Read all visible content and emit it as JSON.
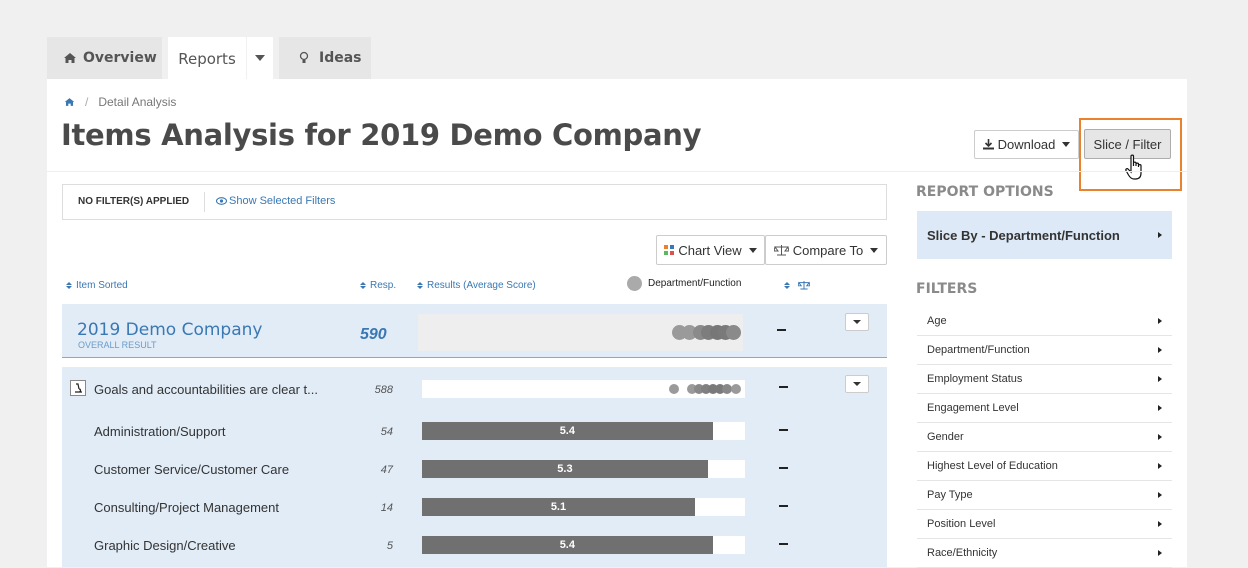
{
  "tabs": {
    "overview": "Overview",
    "reports": "Reports",
    "ideas": "Ideas"
  },
  "breadcrumb": {
    "current": "Detail Analysis"
  },
  "page_title": "Items Analysis for 2019 Demo Company",
  "toolbar": {
    "download_label": "Download",
    "slice_filter_label": "Slice / Filter"
  },
  "filterbar": {
    "status": "NO FILTER(S) APPLIED",
    "show_filters": "Show Selected Filters"
  },
  "view_controls": {
    "chart_view": "Chart View",
    "compare_to": "Compare To"
  },
  "columns": {
    "item_sorted": "Item Sorted",
    "resp": "Resp.",
    "results": "Results (Average Score)",
    "legend": "Department/Function"
  },
  "overall": {
    "name": "2019 Demo Company",
    "sublabel": "OVERALL RESULT",
    "resp": "590"
  },
  "item": {
    "label": "Goals and accountabilities are clear t...",
    "resp": "588"
  },
  "rows": [
    {
      "label": "Administration/Support",
      "resp": "54",
      "score": "5.4",
      "fill": 0.9
    },
    {
      "label": "Customer Service/Customer Care",
      "resp": "47",
      "score": "5.3",
      "fill": 0.885
    },
    {
      "label": "Consulting/Project Management",
      "resp": "14",
      "score": "5.1",
      "fill": 0.845
    },
    {
      "label": "Graphic Design/Creative",
      "resp": "5",
      "score": "5.4",
      "fill": 0.9
    }
  ],
  "report_options": {
    "title": "REPORT OPTIONS",
    "slice_by": "Slice By - Department/Function"
  },
  "filters": {
    "title": "FILTERS",
    "items": [
      "Age",
      "Department/Function",
      "Employment Status",
      "Engagement Level",
      "Gender",
      "Highest Level of Education",
      "Pay Type",
      "Position Level",
      "Race/Ethnicity"
    ]
  },
  "colors": {
    "accent_blue": "#3a78b4",
    "highlight_orange": "#e8822e",
    "row_bg": "#e1ecf7",
    "bar_gray": "#707070"
  }
}
